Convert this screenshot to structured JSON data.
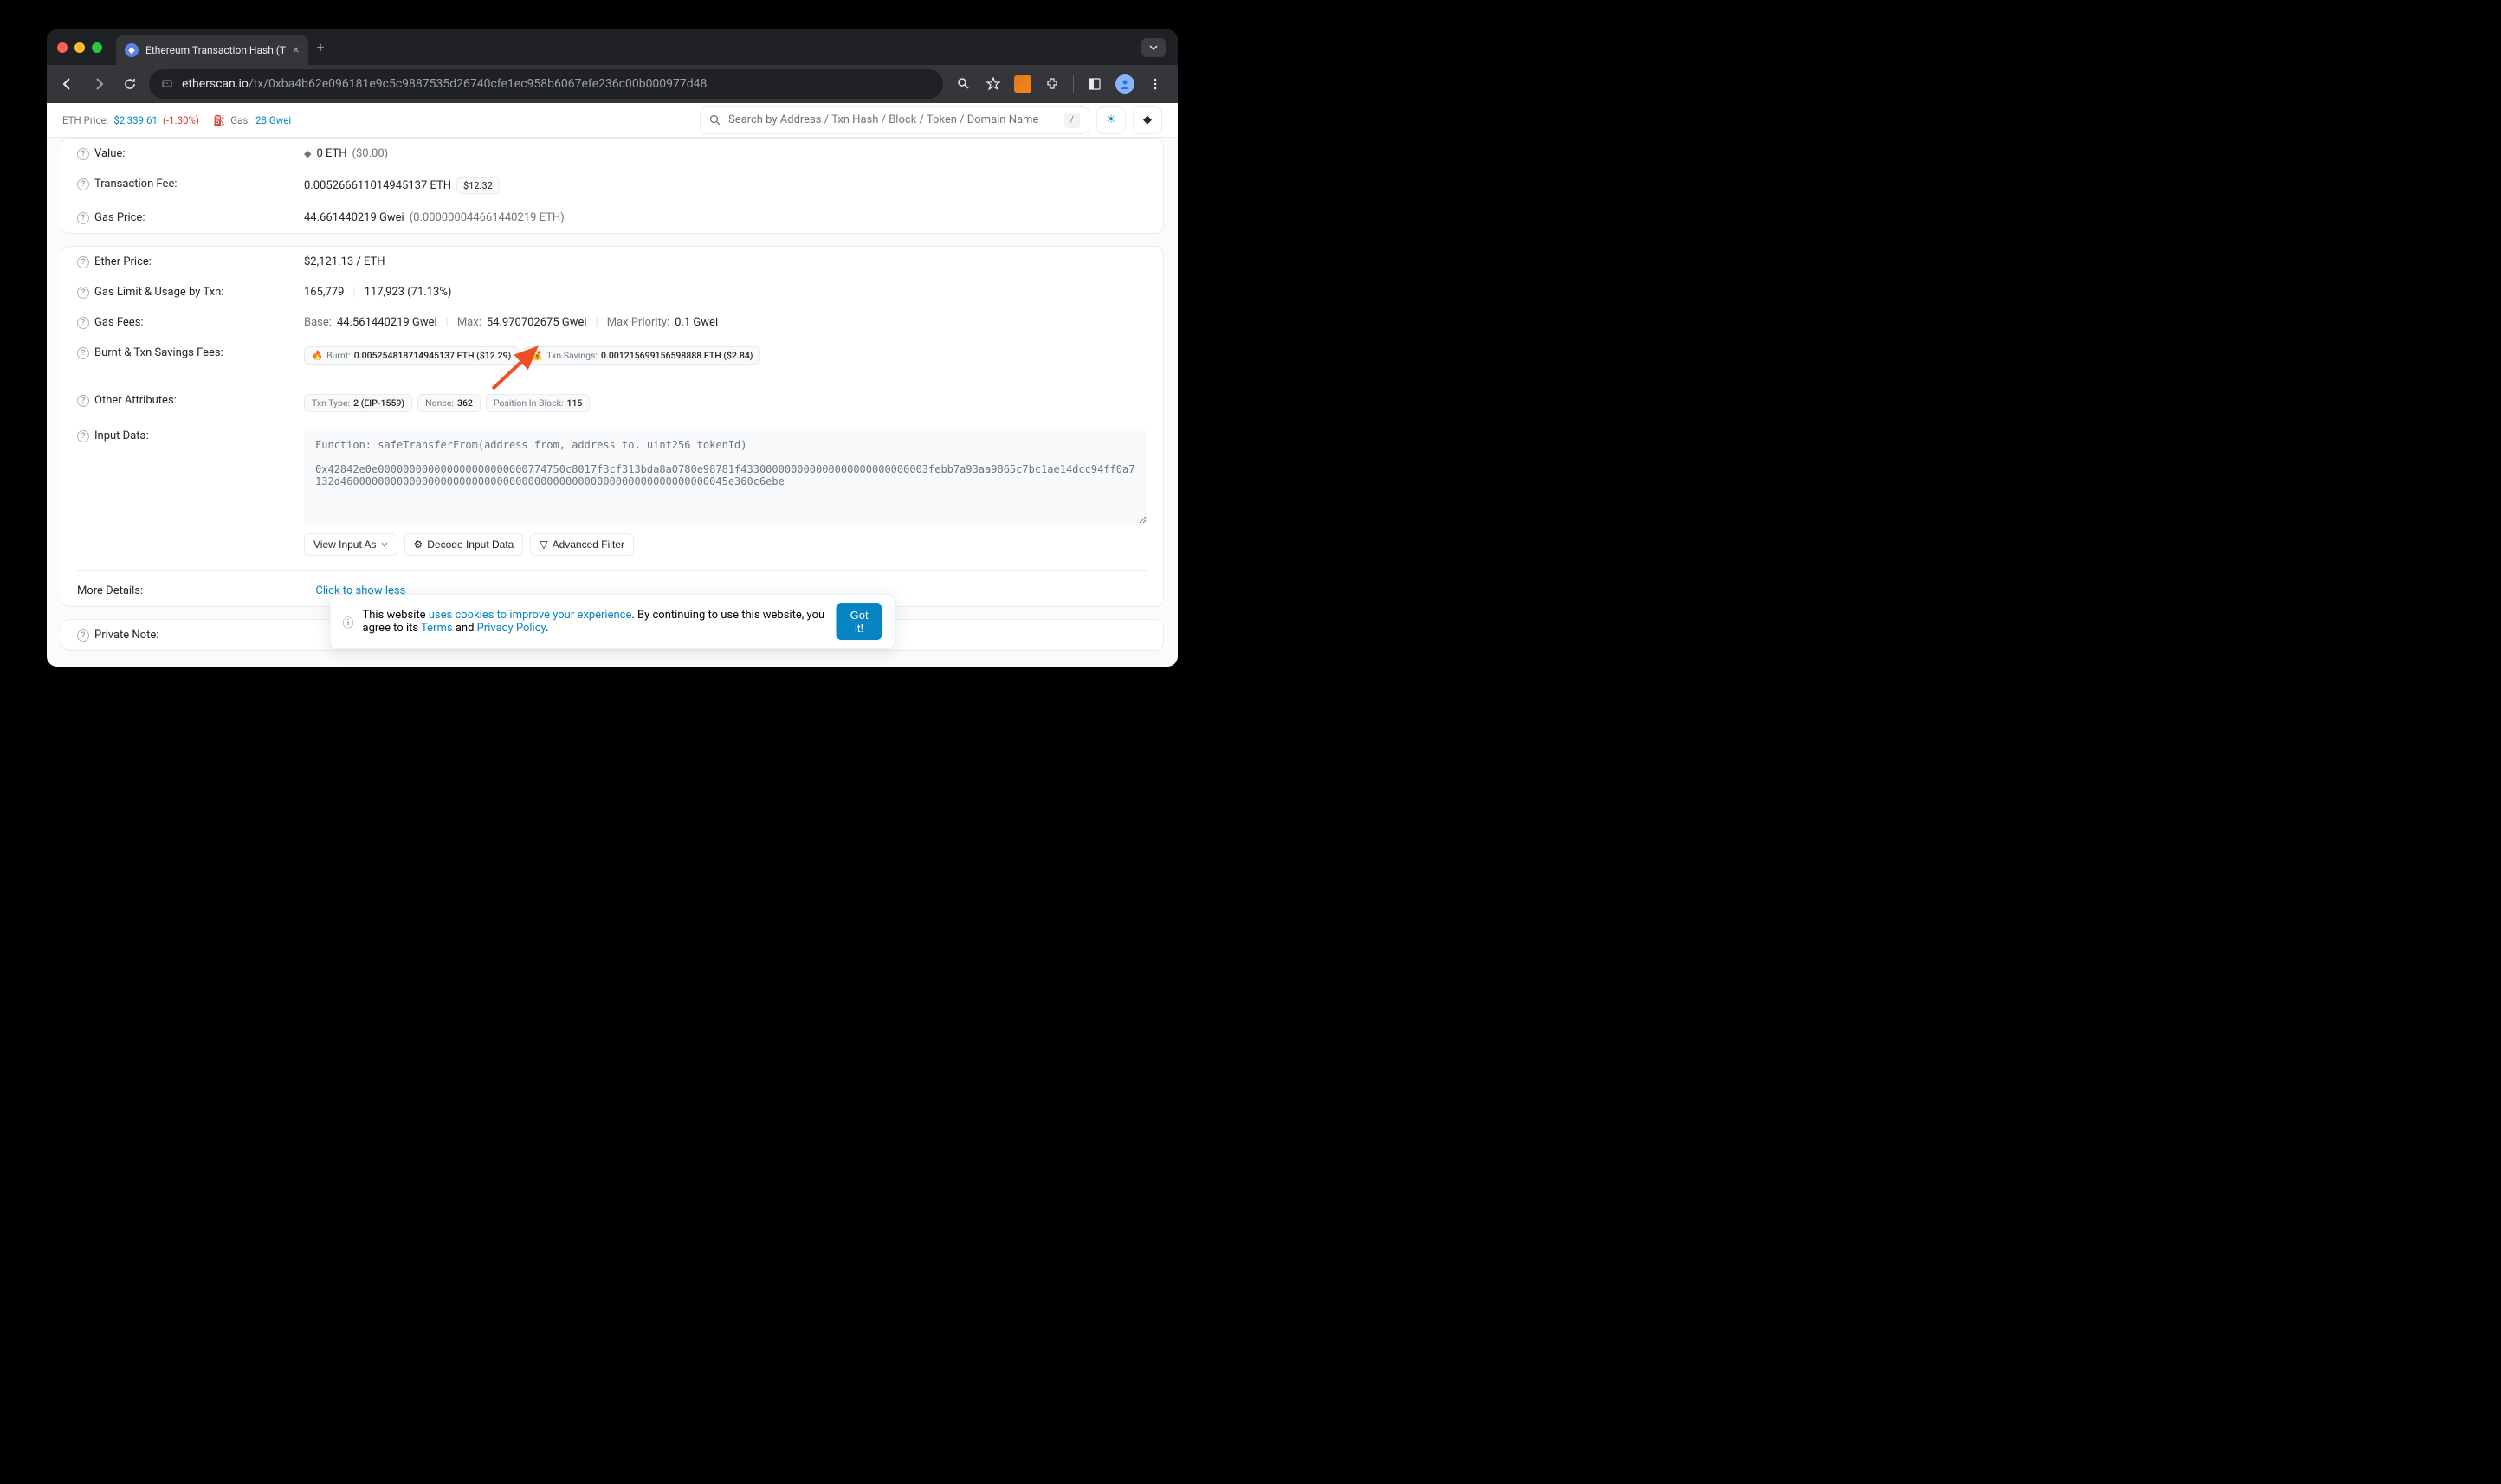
{
  "browser": {
    "tab_title": "Ethereum Transaction Hash (T",
    "url_domain": "etherscan.io",
    "url_path": "/tx/0xba4b62e096181e9c5c9887535d26740cfe1ec958b6067efe236c00b000977d48"
  },
  "header": {
    "eth_price_label": "ETH Price:",
    "eth_price": "$2,339.61",
    "eth_change": "(-1.30%)",
    "gas_label": "Gas:",
    "gas_value": "28 Gwei",
    "search_placeholder": "Search by Address / Txn Hash / Block / Token / Domain Name",
    "search_kbd": "/"
  },
  "rows": {
    "value": {
      "label": "Value:",
      "amount": "0 ETH",
      "usd": "($0.00)"
    },
    "txn_fee": {
      "label": "Transaction Fee:",
      "amount": "0.005266611014945137 ETH",
      "usd": "$12.32"
    },
    "gas_price": {
      "label": "Gas Price:",
      "gwei": "44.661440219 Gwei",
      "eth": "(0.000000044661440219 ETH)"
    },
    "ether_price": {
      "label": "Ether Price:",
      "value": "$2,121.13 / ETH"
    },
    "gas_limit": {
      "label": "Gas Limit & Usage by Txn:",
      "limit": "165,779",
      "used": "117,923 (71.13%)"
    },
    "gas_fees": {
      "label": "Gas Fees:",
      "base_label": "Base:",
      "base": "44.561440219 Gwei",
      "max_label": "Max:",
      "max": "54.970702675 Gwei",
      "maxp_label": "Max Priority:",
      "maxp": "0.1 Gwei"
    },
    "burnt": {
      "label": "Burnt & Txn Savings Fees:",
      "burnt_label": "Burnt:",
      "burnt_val": "0.005254818714945137 ETH ($12.29)",
      "savings_label": "Txn Savings:",
      "savings_val": "0.001215699156598888 ETH ($2.84)"
    },
    "other": {
      "label": "Other Attributes:",
      "txtype_label": "Txn Type:",
      "txtype_val": "2 (EIP-1559)",
      "nonce_label": "Nonce:",
      "nonce_val": "362",
      "pos_label": "Position In Block:",
      "pos_val": "115"
    },
    "input": {
      "label": "Input Data:",
      "text": "Function: safeTransferFrom(address from, address to, uint256 tokenId)\n\n0x42842e0e000000000000000000000000774750c8017f3cf313bda8a0780e98781f433000000000000000000000000003febb7a93aa9865c7bc1ae14dcc94ff0a7132d46000000000000000000000000000000000000000000000000000000000045e360c6ebe"
    },
    "more": {
      "label": "More Details:",
      "link": "Click to show less"
    },
    "private_note": {
      "label": "Private Note:"
    }
  },
  "buttons": {
    "view_input": "View Input As",
    "decode": "Decode Input Data",
    "adv_filter": "Advanced Filter"
  },
  "cookie": {
    "text1": "This website ",
    "link1": "uses cookies to improve your experience",
    "text2": ". By continuing to use this website, you agree to its ",
    "terms": "Terms",
    "and": " and ",
    "privacy": "Privacy Policy",
    "period": ".",
    "got_it": "Got it!"
  }
}
